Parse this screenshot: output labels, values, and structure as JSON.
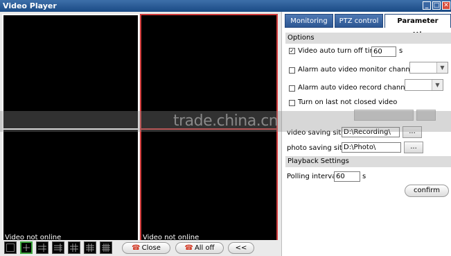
{
  "window": {
    "title": "Video Player"
  },
  "video": {
    "panels": [
      {
        "status": ""
      },
      {
        "status": ""
      },
      {
        "status": "Video not online"
      },
      {
        "status": "Video not online"
      }
    ]
  },
  "toolbar": {
    "close_label": "Close",
    "all_off_label": "All off",
    "collapse_label": "<<"
  },
  "tabs": [
    "Monitoring",
    "PTZ control",
    "Parameter setting"
  ],
  "options": {
    "header": "Options",
    "auto_off_label": "Video auto turn off time",
    "auto_off_value": "60",
    "auto_off_unit": "s",
    "alarm_monitor_label": "Alarm auto video monitor channel:",
    "alarm_record_label": "Alarm auto video record channel:",
    "turn_on_label": "Turn on last not closed video",
    "video_site_label": "video saving site",
    "video_site_value": "D:\\Recording\\",
    "photo_site_label": "photo saving site",
    "photo_site_value": "D:\\Photo\\",
    "browse_label": "..."
  },
  "playback": {
    "header": "Playback Settings",
    "polling_label": "Polling interval",
    "polling_value": "60",
    "polling_unit": "s",
    "confirm_label": "confirm"
  },
  "watermark": {
    "text": "trade.china.cn"
  }
}
